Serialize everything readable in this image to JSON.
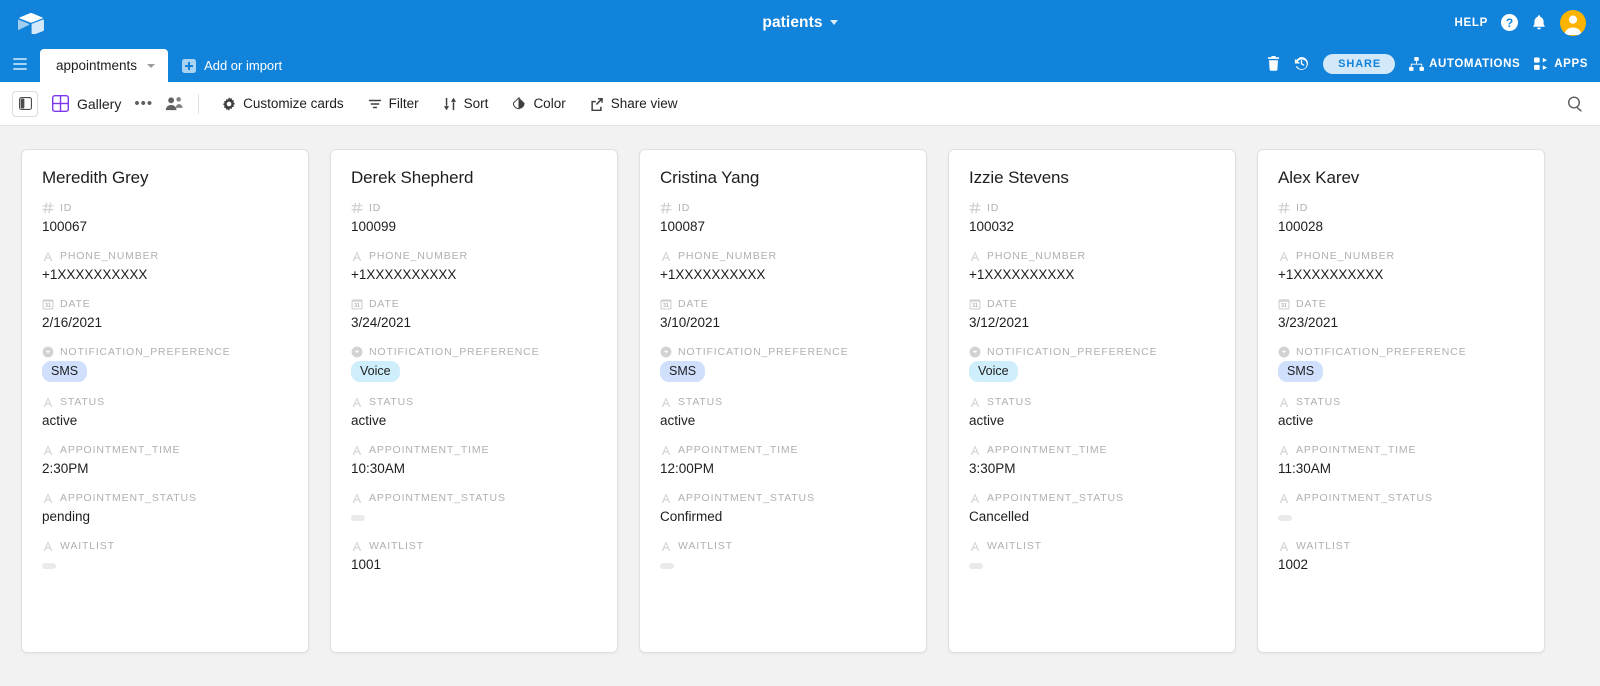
{
  "topbar": {
    "logo_icon": "airtable-logo-icon",
    "base_title": "patients",
    "base_caret_icon": "chevron-down-icon",
    "help_label": "HELP",
    "help_icon": "question-mark-icon",
    "notifications_icon": "bell-icon",
    "account_icon": "user-avatar-icon",
    "brand_color": "#1283da",
    "avatar_color": "#fcb400"
  },
  "tabbar": {
    "menu_icon": "hamburger-menu-icon",
    "active_table": "appointments",
    "table_caret_icon": "chevron-down-icon",
    "add_or_import": "Add or import",
    "add_icon": "plus-square-icon",
    "trash_icon": "trash-icon",
    "history_icon": "clock-history-icon",
    "share_label": "SHARE",
    "automations_label": "AUTOMATIONS",
    "automations_icon": "automations-icon",
    "apps_label": "APPS",
    "apps_icon": "apps-icon"
  },
  "toolbar": {
    "sidebar_toggle_icon": "sidebar-toggle-icon",
    "view_type_icon": "gallery-grid-icon",
    "view_name": "Gallery",
    "more_icon": "ellipsis-icon",
    "collaborators_icon": "collaborators-icon",
    "customize_cards": "Customize cards",
    "customize_icon": "gear-icon",
    "filter": "Filter",
    "filter_icon": "filter-icon",
    "sort": "Sort",
    "sort_icon": "sort-arrows-icon",
    "color": "Color",
    "color_icon": "paint-drop-icon",
    "share_view": "Share view",
    "share_view_icon": "share-box-icon",
    "search_icon": "search-icon"
  },
  "field_labels": {
    "id": "ID",
    "phone_number": "PHONE_NUMBER",
    "date": "DATE",
    "notification_preference": "NOTIFICATION_PREFERENCE",
    "status": "STATUS",
    "appointment_time": "APPOINTMENT_TIME",
    "appointment_status": "APPOINTMENT_STATUS",
    "waitlist": "WAITLIST"
  },
  "field_icons": {
    "id": "number-field-icon",
    "phone_number": "text-field-icon",
    "date": "calendar-field-icon",
    "notification_preference": "single-select-field-icon",
    "status": "text-field-icon",
    "appointment_time": "text-field-icon",
    "appointment_status": "text-field-icon",
    "waitlist": "text-field-icon"
  },
  "cards": [
    {
      "name": "Meredith Grey",
      "id": "100067",
      "phone_number": "+1XXXXXXXXXX",
      "date": "2/16/2021",
      "notification_preference": "SMS",
      "notification_pill_class": "pill-sms",
      "status": "active",
      "appointment_time": "2:30PM",
      "appointment_status": "pending",
      "waitlist": ""
    },
    {
      "name": "Derek Shepherd",
      "id": "100099",
      "phone_number": "+1XXXXXXXXXX",
      "date": "3/24/2021",
      "notification_preference": "Voice",
      "notification_pill_class": "pill-voice",
      "status": "active",
      "appointment_time": "10:30AM",
      "appointment_status": "",
      "waitlist": "1001"
    },
    {
      "name": "Cristina Yang",
      "id": "100087",
      "phone_number": "+1XXXXXXXXXX",
      "date": "3/10/2021",
      "notification_preference": "SMS",
      "notification_pill_class": "pill-sms",
      "status": "active",
      "appointment_time": "12:00PM",
      "appointment_status": "Confirmed",
      "waitlist": ""
    },
    {
      "name": "Izzie Stevens",
      "id": "100032",
      "phone_number": "+1XXXXXXXXXX",
      "date": "3/12/2021",
      "notification_preference": "Voice",
      "notification_pill_class": "pill-voice",
      "status": "active",
      "appointment_time": "3:30PM",
      "appointment_status": "Cancelled",
      "waitlist": ""
    },
    {
      "name": "Alex Karev",
      "id": "100028",
      "phone_number": "+1XXXXXXXXXX",
      "date": "3/23/2021",
      "notification_preference": "SMS",
      "notification_pill_class": "pill-sms",
      "status": "active",
      "appointment_time": "11:30AM",
      "appointment_status": "",
      "waitlist": "1002"
    }
  ]
}
